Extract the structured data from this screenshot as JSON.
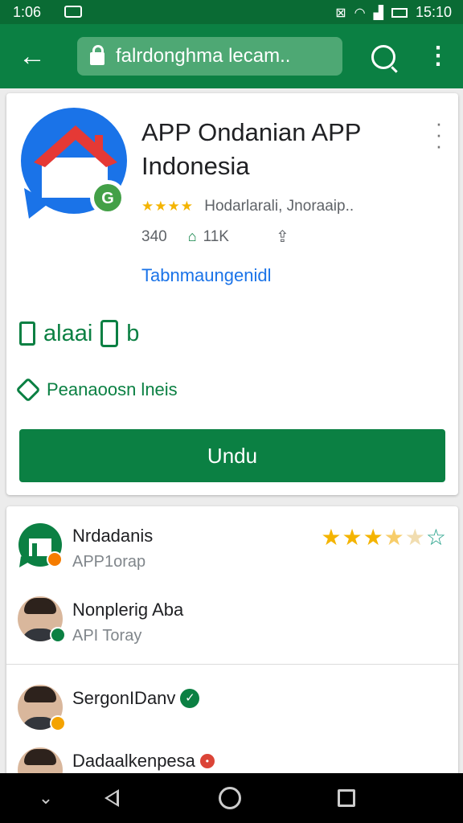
{
  "status_bar": {
    "time": "1:06",
    "right_text": "15:10",
    "icons": [
      "notification-icon",
      "nfc-icon",
      "wifi-icon",
      "signal-icon",
      "battery-icon"
    ]
  },
  "app_bar": {
    "url": "falrdonghma lecam..",
    "icons": [
      "back-arrow-icon",
      "lock-icon",
      "search-icon",
      "more-vert-icon"
    ]
  },
  "app": {
    "title": "APP Ondanian APP Indonesia",
    "rating_stars": "★★★★",
    "rating_text": "Hodarlarali, Jnoraaip..",
    "count": "340",
    "downloads": "11K",
    "developer_link": "Tabnmaungenidl",
    "feature_1": "alaai",
    "feature_1_suffix": "b",
    "feature_2": "Peanaoosn lneis",
    "install_label": "Undu",
    "colors": {
      "brand": "#0b8043",
      "link": "#1a73e8",
      "star": "#f4b400"
    }
  },
  "reviews": [
    {
      "name": "Nrdadanis",
      "subtitle": "APP1orap",
      "stars": 3.5,
      "badge": "#f57c00"
    },
    {
      "name": "Nonplerig Aba",
      "subtitle": "API Toray",
      "badge": "#0b8043"
    },
    {
      "name": "SergonIDanv",
      "subtitle": "",
      "badge": "#f4a300",
      "verified": true
    },
    {
      "name": "Dadaalkenpesa",
      "subtitle": "",
      "badge": "#0b8043",
      "red_badge": true
    }
  ],
  "nav_bar": {
    "icons": [
      "chevron-down-icon",
      "back-triangle-icon",
      "home-circle-icon",
      "recents-square-icon"
    ]
  }
}
